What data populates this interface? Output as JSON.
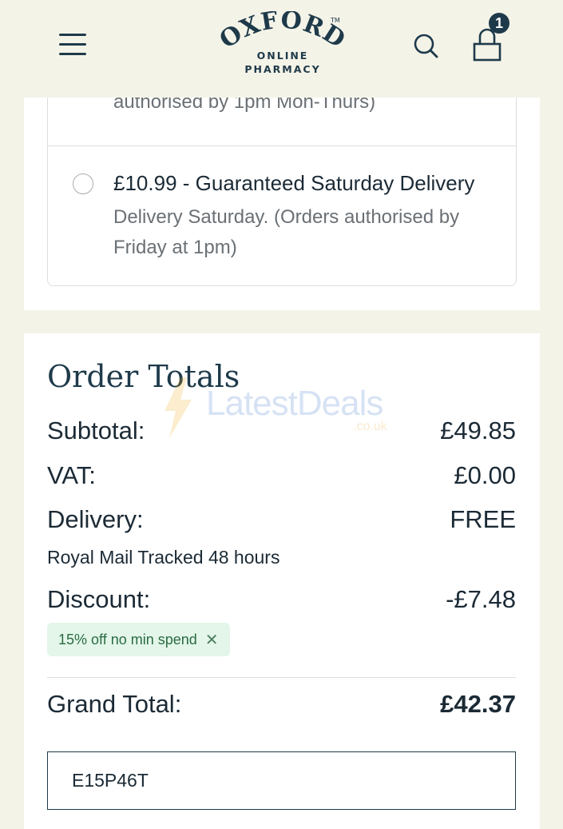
{
  "header": {
    "brand_main": "OXFORD",
    "brand_tm": "TM",
    "brand_sub1": "ONLINE",
    "brand_sub2": "PHARMACY",
    "cart_count": "1"
  },
  "delivery": {
    "previous_option_tail": "authorised by 1pm Mon-Thurs)",
    "saturday_option": {
      "title": "£10.99 - Guaranteed Saturday Delivery",
      "description": "Delivery Saturday. (Orders authorised by Friday at 1pm)",
      "selected": false
    }
  },
  "order_totals": {
    "title": "Order Totals",
    "subtotal_label": "Subtotal:",
    "subtotal_value": "£49.85",
    "vat_label": "VAT:",
    "vat_value": "£0.00",
    "delivery_label": "Delivery:",
    "delivery_value": "FREE",
    "delivery_method": "Royal Mail Tracked 48 hours",
    "discount_label": "Discount:",
    "discount_value": "-£7.48",
    "discount_code_label": "15% off no min spend",
    "grand_total_label": "Grand Total:",
    "grand_total_value": "£42.37",
    "promo_input_value": "E15P46T"
  },
  "watermark": {
    "text": "LatestDeals",
    "domain": ".co.uk"
  },
  "icons": {
    "menu": "hamburger-menu-icon",
    "search": "search-icon",
    "cart": "shopping-bag-icon",
    "chip_close": "close-icon"
  },
  "colors": {
    "page_bg": "#f4f3e8",
    "brand_navy": "#1e3a4a",
    "chip_bg": "#e3f6e9",
    "chip_text": "#2b6b43"
  }
}
